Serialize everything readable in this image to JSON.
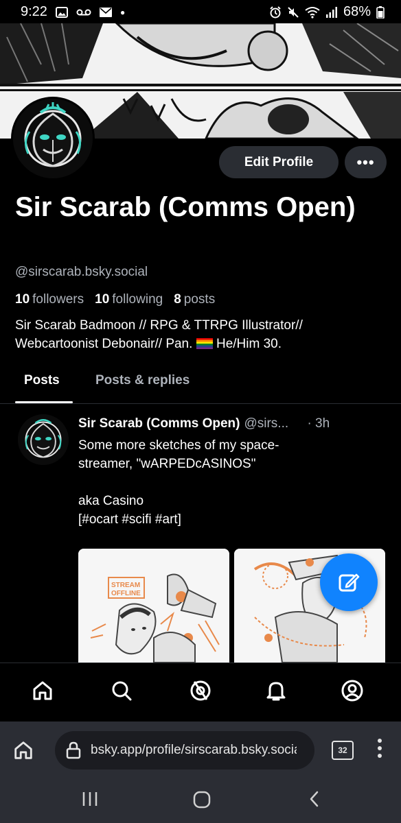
{
  "status_bar": {
    "time": "9:22",
    "battery": "68%",
    "left_icons": [
      "gallery-icon",
      "voicemail-icon",
      "mail-icon",
      "dot-icon"
    ],
    "right_icons": [
      "alarm-icon",
      "mute-icon",
      "wifi-icon",
      "signal-icon",
      "battery-icon"
    ]
  },
  "profile": {
    "edit_label": "Edit Profile",
    "more_label": "•••",
    "display_name": "Sir Scarab (Comms Open)",
    "handle": "@sirscarab.bsky.social",
    "followers_count": "10",
    "followers_label": "followers",
    "following_count": "10",
    "following_label": "following",
    "posts_count": "8",
    "posts_label": "posts",
    "bio_line1": "Sir Scarab Badmoon // RPG & TTRPG Illustrator//",
    "bio_line2_pre": "Webcartoonist Debonair// Pan. ",
    "bio_line2_post": " He/Him 30."
  },
  "tabs": [
    {
      "label": "Posts",
      "active": true
    },
    {
      "label": "Posts & replies",
      "active": false
    }
  ],
  "post": {
    "author": "Sir Scarab (Comms Open)",
    "handle": "@sirs...",
    "time": "· 3h",
    "text": "Some more sketches of my space-\nstreamer, \"wARPEDcASINOS\"\n\naka Casino\n[#ocart #scifi #art]",
    "image1_text": [
      "STREAM",
      "OFFLINE"
    ]
  },
  "fab": {
    "icon": "compose-icon"
  },
  "bottom_nav": [
    {
      "icon": "home-icon"
    },
    {
      "icon": "search-icon"
    },
    {
      "icon": "feeds-icon"
    },
    {
      "icon": "notifications-icon"
    },
    {
      "icon": "profile-icon"
    }
  ],
  "browser": {
    "url": "bsky.app/profile/sirscarab.bsky.social",
    "tab_count": "32"
  },
  "colors": {
    "background": "#000000",
    "accent": "#1083fe",
    "button_bg": "#2a2d33",
    "muted_text": "#aeb3bb",
    "browser_bar": "#2b2d34",
    "sketch_orange": "#e8894a"
  }
}
